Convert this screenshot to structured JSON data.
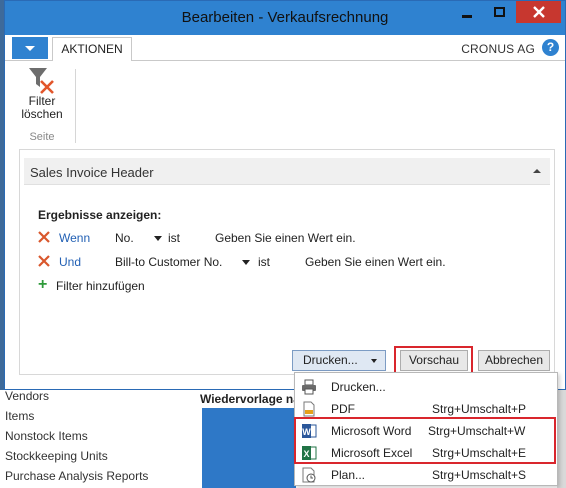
{
  "window": {
    "title": "Bearbeiten - Verkaufsrechnung",
    "company": "CRONUS AG",
    "tab_actions": "AKTIONEN"
  },
  "ribbon": {
    "clear_filter_line1": "Filter",
    "clear_filter_line2": "löschen",
    "group_label": "Seite"
  },
  "filter_panel": {
    "section_title": "Sales Invoice Header",
    "results_label": "Ergebnisse anzeigen:",
    "rows": [
      {
        "keyword": "Wenn",
        "field": "No.",
        "operator": "ist",
        "value": "Geben Sie einen Wert ein."
      },
      {
        "keyword": "Und",
        "field": "Bill-to Customer No.",
        "operator": "ist",
        "value": "Geben Sie einen Wert ein."
      }
    ],
    "add_filter": "Filter hinzufügen"
  },
  "buttons": {
    "print": "Drucken...",
    "preview": "Vorschau",
    "cancel": "Abbrechen"
  },
  "print_menu": [
    {
      "label": "Drucken...",
      "shortcut": "",
      "icon": "printer-icon"
    },
    {
      "label": "PDF",
      "shortcut": "Strg+Umschalt+P",
      "icon": "pdf-icon"
    },
    {
      "label": "Microsoft Word",
      "shortcut": "Strg+Umschalt+W",
      "icon": "word-icon"
    },
    {
      "label": "Microsoft Excel",
      "shortcut": "Strg+Umschalt+E",
      "icon": "excel-icon"
    },
    {
      "label": "Plan...",
      "shortcut": "Strg+Umschalt+S",
      "icon": "schedule-icon"
    }
  ],
  "background": {
    "list_items": [
      "Vendors",
      "Items",
      "Nonstock Items",
      "Stockkeeping Units",
      "Purchase Analysis Reports"
    ],
    "heading": "Wiedervorlage na"
  },
  "colors": {
    "titlebar": "#2f82d0",
    "close_button": "#c7372f",
    "highlight": "#d9262d",
    "link_blue": "#2260b4"
  }
}
